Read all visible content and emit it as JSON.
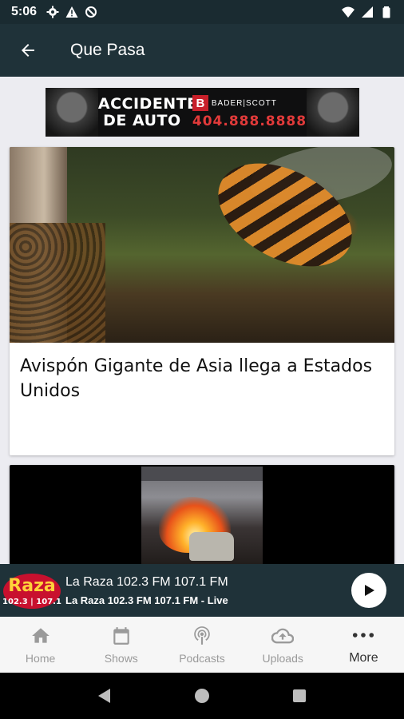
{
  "status_bar": {
    "time": "5:06",
    "icons_left": [
      "gear-icon",
      "warning-icon",
      "data-saver-icon"
    ],
    "icons_right": [
      "wifi-icon",
      "signal-icon",
      "battery-icon"
    ]
  },
  "app_bar": {
    "title": "Que Pasa",
    "back_icon": "arrow-back-icon"
  },
  "ad": {
    "headline_line1": "ACCIDENTES",
    "headline_line2": "DE AUTO",
    "brand_logo": "B",
    "brand_name": "BADER|SCOTT",
    "phone": "404.888.8888"
  },
  "articles": [
    {
      "title": "Avispón Gigante de Asia llega a Estados Unidos",
      "image": "giant-hornet-photo"
    },
    {
      "title": "",
      "image": "car-fire-photo"
    }
  ],
  "player": {
    "logo_text": "Raza",
    "logo_freq": "102.3 | 107.1",
    "station": "La Raza 102.3 FM 107.1 FM",
    "status": "La Raza 102.3 FM 107.1 FM - Live",
    "play_icon": "play-icon"
  },
  "bottom_nav": [
    {
      "label": "Home",
      "icon": "home-icon",
      "active": false
    },
    {
      "label": "Shows",
      "icon": "calendar-icon",
      "active": false
    },
    {
      "label": "Podcasts",
      "icon": "podcast-icon",
      "active": false
    },
    {
      "label": "Uploads",
      "icon": "cloud-upload-icon",
      "active": false
    },
    {
      "label": "More",
      "icon": "more-dots-icon",
      "active": true
    }
  ],
  "system_nav": [
    "back-triangle-icon",
    "home-circle-icon",
    "recents-square-icon"
  ],
  "colors": {
    "app_bar": "#1f3239",
    "status_bar": "#1a2b31",
    "background": "#ececf1",
    "nav_inactive": "#9a9a9a",
    "nav_active": "#333333"
  }
}
